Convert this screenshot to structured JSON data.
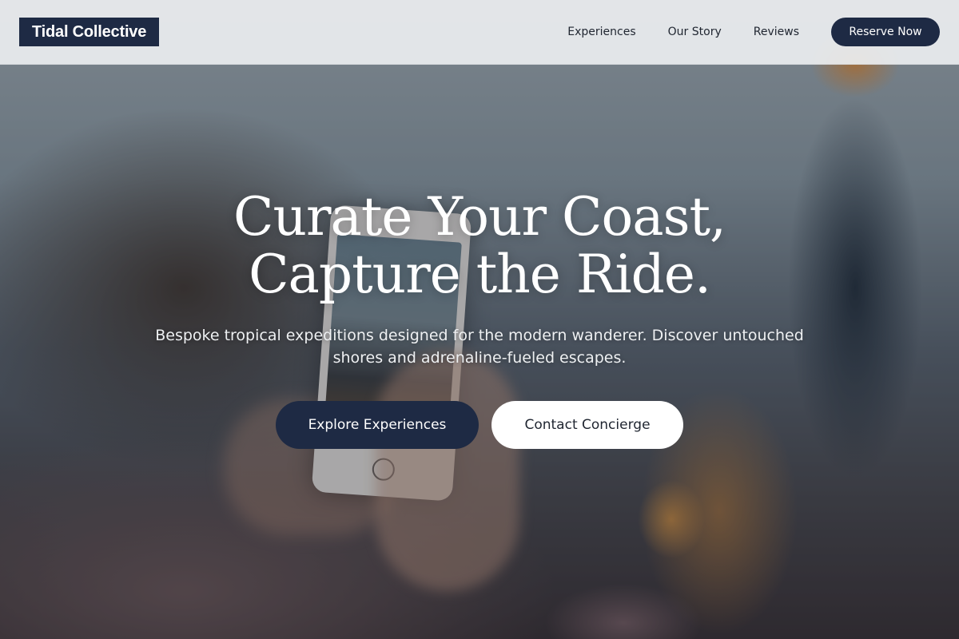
{
  "brand": {
    "name": "Tidal Collective",
    "accent": "#1e2a44"
  },
  "nav": {
    "items": [
      "Experiences",
      "Our Story",
      "Reviews"
    ],
    "cta_label": "Reserve Now"
  },
  "hero": {
    "title_line1": "Curate Your Coast,",
    "title_line2": "Capture the Ride.",
    "subtitle": "Bespoke tropical expeditions designed for the modern wanderer. Discover untouched shores and adrenaline-fueled escapes.",
    "primary_cta": "Explore Experiences",
    "secondary_cta": "Contact Concierge",
    "background": "photo of a person photographing a blurred evening city scene on a smartphone"
  }
}
